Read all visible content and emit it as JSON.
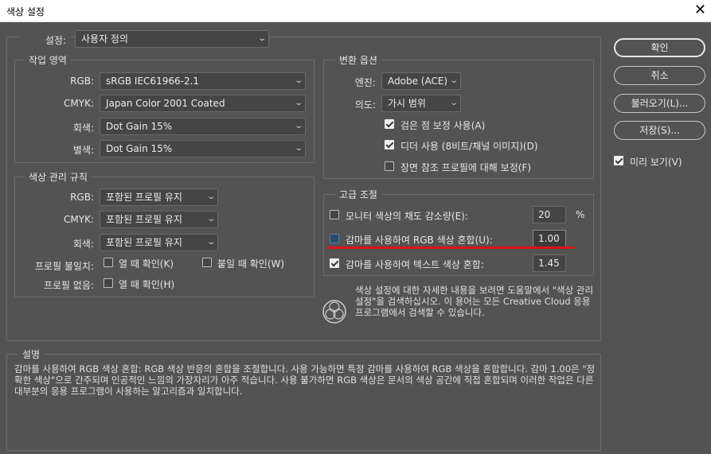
{
  "window": {
    "title": "색상 설정"
  },
  "settings": {
    "label": "설정:",
    "value": "사용자 정의"
  },
  "working_spaces": {
    "title": "작업 영역",
    "rgb_label": "RGB:",
    "rgb_value": "sRGB IEC61966-2.1",
    "cmyk_label": "CMYK:",
    "cmyk_value": "Japan Color 2001 Coated",
    "gray_label": "회색:",
    "gray_value": "Dot Gain 15%",
    "spot_label": "별색:",
    "spot_value": "Dot Gain 15%"
  },
  "policies": {
    "title": "색상 관리 규칙",
    "rgb_label": "RGB:",
    "rgb_value": "포함된 프로필 유지",
    "cmyk_label": "CMYK:",
    "cmyk_value": "포함된 프로필 유지",
    "gray_label": "회색:",
    "gray_value": "포함된 프로필 유지",
    "mismatch_label": "프로필 불일치:",
    "mismatch_open": "열 때 확인(K)",
    "mismatch_paste": "붙일 때 확인(W)",
    "missing_label": "프로필 없음:",
    "missing_open": "열 때 확인(H)"
  },
  "conversion": {
    "title": "변환 옵션",
    "engine_label": "엔진:",
    "engine_value": "Adobe (ACE)",
    "intent_label": "의도:",
    "intent_value": "가시 범위",
    "bpc": "검은 점 보정 사용(A)",
    "dither": "디더 사용 (8비트/채널 이미지)(D)",
    "scene": "장면 참조 프로필에 대해 보정(F)"
  },
  "advanced": {
    "title": "고급 조절",
    "desaturate_label": "모니터 색상의 채도 감소량(E):",
    "desaturate_value": "20",
    "desaturate_unit": "%",
    "blend_rgb_label": "감마를 사용하여 RGB 색상 혼합(U):",
    "blend_rgb_value": "1.00",
    "blend_text_label": "감마를 사용하여 텍스트 색상 혼합:",
    "blend_text_value": "1.45"
  },
  "info": {
    "text": "색상 설정에 대한 자세한 내용을 보려면 도움말에서 \"색상 관리 설정\"을 검색하십시오. 이 용어는 모든 Creative Cloud 응용 프로그램에서 검색할 수 있습니다."
  },
  "description": {
    "title": "설명",
    "text": "감마를 사용하여 RGB 색상 혼합: RGB 색상 반응의 혼합을 조절합니다. 사용 가능하면 특정 감마를 사용하여 RGB 색상을 혼합합니다. 감마 1.00은 \"정확한 색상\"으로 간주되며 인공적인 느낌의 가장자리가 아주 적습니다. 사용 불가하면 RGB 색상은 문서의 색상 공간에 직접 혼합되며 이러한 작업은 다른 대부분의 응용 프로그램이 사용하는 알고리즘과 일치합니다."
  },
  "buttons": {
    "ok": "확인",
    "cancel": "취소",
    "load": "불러오기(L)...",
    "save": "저장(S)..."
  },
  "preview": {
    "label": "미리 보기(V)",
    "checked": true
  },
  "colors": {
    "background": "#535353",
    "highlight": "#e0101a"
  }
}
